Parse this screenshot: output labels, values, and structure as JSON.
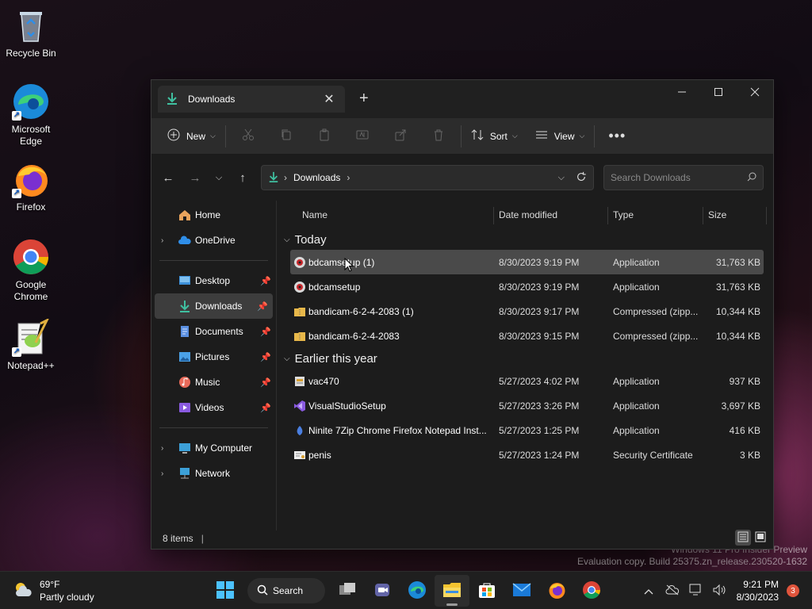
{
  "desktop": {
    "icons": [
      {
        "label": "Recycle Bin"
      },
      {
        "label": "Microsoft Edge"
      },
      {
        "label": "Firefox"
      },
      {
        "label": "Google Chrome"
      },
      {
        "label": "Notepad++"
      }
    ],
    "watermark": {
      "line1": "Windows 11 Pro Insider Preview",
      "line2": "Evaluation copy. Build 25375.zn_release.230520-1632"
    }
  },
  "window": {
    "tab_title": "Downloads",
    "commandbar": {
      "new_label": "New",
      "sort_label": "Sort",
      "view_label": "View"
    },
    "address": {
      "current": "Downloads",
      "search_placeholder": "Search Downloads"
    },
    "nav": {
      "home": "Home",
      "onedrive": "OneDrive",
      "pinned": [
        {
          "label": "Desktop",
          "icon": "desktop-folder-icon"
        },
        {
          "label": "Downloads",
          "icon": "downloads-folder-icon"
        },
        {
          "label": "Documents",
          "icon": "documents-folder-icon"
        },
        {
          "label": "Pictures",
          "icon": "pictures-folder-icon"
        },
        {
          "label": "Music",
          "icon": "music-folder-icon"
        },
        {
          "label": "Videos",
          "icon": "videos-folder-icon"
        }
      ],
      "my_computer": "My Computer",
      "network": "Network"
    },
    "columns": {
      "name": "Name",
      "date": "Date modified",
      "type": "Type",
      "size": "Size"
    },
    "groups": [
      {
        "label": "Today",
        "files": [
          {
            "name": "bdcamsetup (1)",
            "date": "8/30/2023 9:19 PM",
            "type": "Application",
            "size": "31,763 KB",
            "icon": "bandicam-setup-icon"
          },
          {
            "name": "bdcamsetup",
            "date": "8/30/2023 9:19 PM",
            "type": "Application",
            "size": "31,763 KB",
            "icon": "bandicam-setup-icon"
          },
          {
            "name": "bandicam-6-2-4-2083 (1)",
            "date": "8/30/2023 9:17 PM",
            "type": "Compressed (zipp...",
            "size": "10,344 KB",
            "icon": "zip-folder-icon"
          },
          {
            "name": "bandicam-6-2-4-2083",
            "date": "8/30/2023 9:15 PM",
            "type": "Compressed (zipp...",
            "size": "10,344 KB",
            "icon": "zip-folder-icon"
          }
        ]
      },
      {
        "label": "Earlier this year",
        "files": [
          {
            "name": "vac470",
            "date": "5/27/2023 4:02 PM",
            "type": "Application",
            "size": "937 KB",
            "icon": "installer-icon"
          },
          {
            "name": "VisualStudioSetup",
            "date": "5/27/2023 3:26 PM",
            "type": "Application",
            "size": "3,697 KB",
            "icon": "visual-studio-icon"
          },
          {
            "name": "Ninite 7Zip Chrome Firefox Notepad Inst...",
            "date": "5/27/2023 1:25 PM",
            "type": "Application",
            "size": "416 KB",
            "icon": "ninite-icon"
          },
          {
            "name": "penis",
            "date": "5/27/2023 1:24 PM",
            "type": "Security Certificate",
            "size": "3 KB",
            "icon": "certificate-icon"
          }
        ]
      }
    ],
    "status": {
      "items": "8 items"
    }
  },
  "taskbar": {
    "weather": {
      "temp": "69°F",
      "condition": "Partly cloudy"
    },
    "search_label": "Search",
    "clock": {
      "time": "9:21 PM",
      "date": "8/30/2023"
    },
    "notification_count": "3"
  }
}
